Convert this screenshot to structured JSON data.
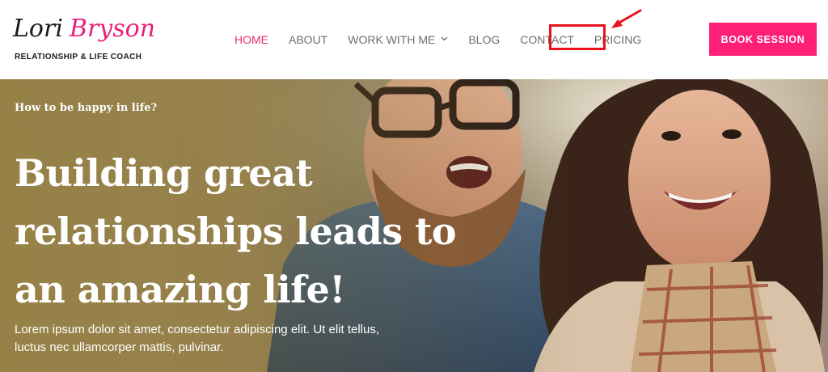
{
  "brand": {
    "first_name": "Lori",
    "last_name": "Bryson",
    "tagline": "RELATIONSHIP & LIFE COACH",
    "accent_color": "#ff1f77"
  },
  "nav": {
    "items": [
      {
        "label": "HOME",
        "active": true
      },
      {
        "label": "ABOUT",
        "active": false
      },
      {
        "label": "WORK WITH ME",
        "active": false,
        "has_dropdown": true
      },
      {
        "label": "BLOG",
        "active": false
      },
      {
        "label": "CONTACT",
        "active": false
      },
      {
        "label": "PRICING",
        "active": false,
        "highlighted": true
      }
    ],
    "dropdown_icon": "chevron-down-icon"
  },
  "cta": {
    "label": "BOOK SESSION"
  },
  "annotation": {
    "highlight_color": "#e8121c",
    "arrow_icon": "red-arrow-icon"
  },
  "hero": {
    "eyebrow": "How to be happy in life?",
    "headline_lines": [
      "Building great",
      "relationships leads to",
      "an amazing life!"
    ],
    "body_lines": [
      "Lorem ipsum dolor sit amet, consectetur adipiscing elit. Ut elit tellus,",
      "luctus nec ullamcorper mattis, pulvinar."
    ]
  }
}
